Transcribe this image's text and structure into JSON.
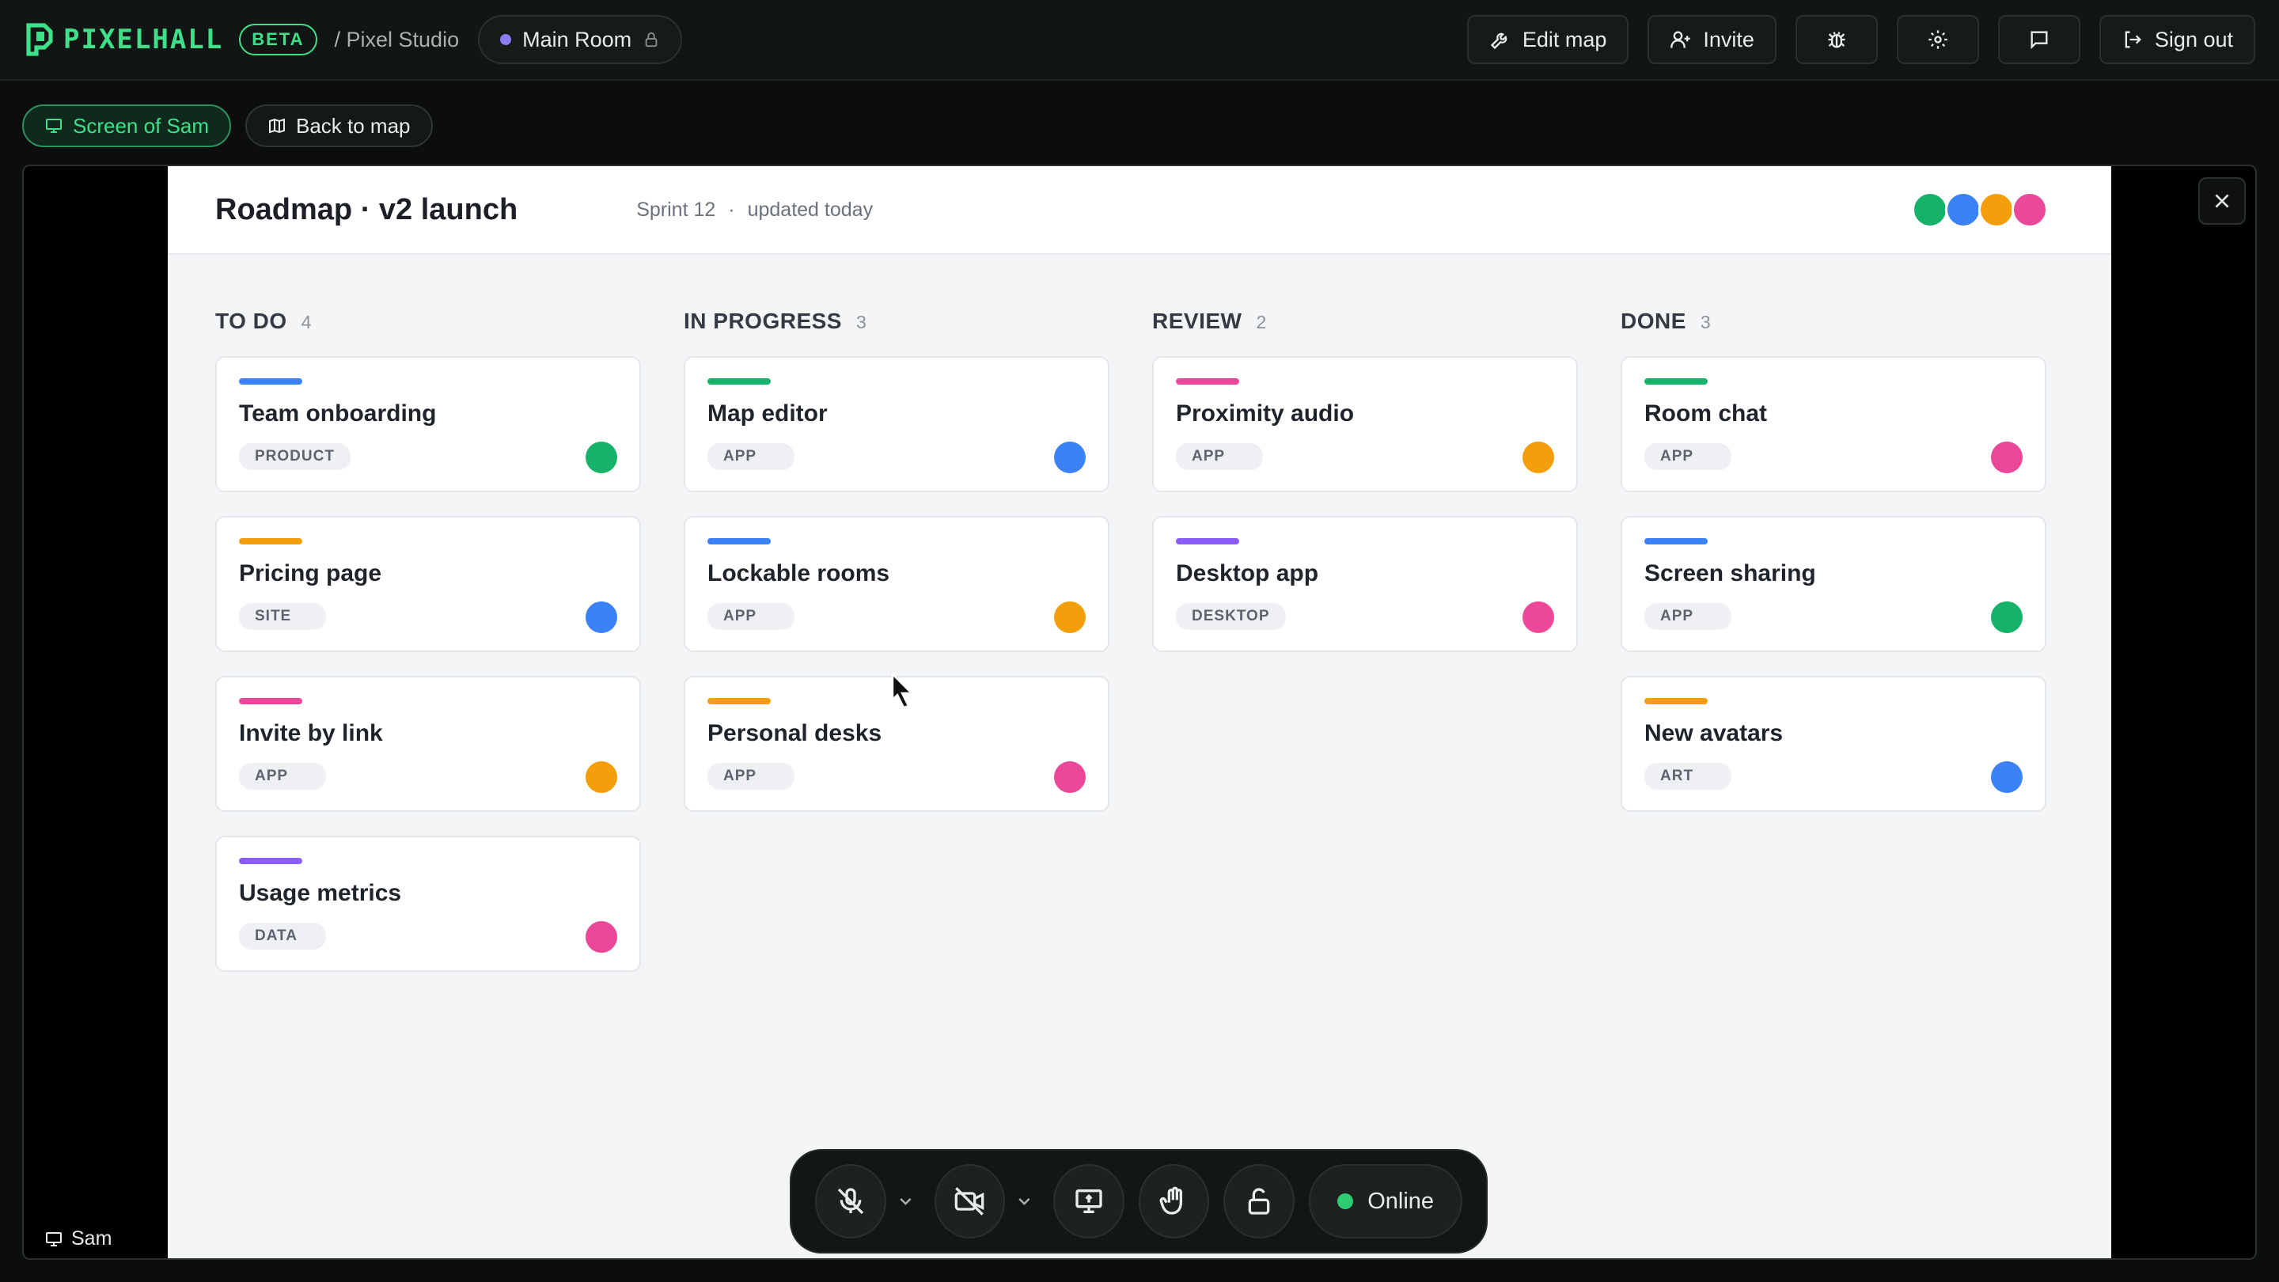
{
  "topbar": {
    "brand": "PIXELHALL",
    "badge": "BETA",
    "breadcrumb": "/ Pixel Studio",
    "room": "Main Room",
    "actions": {
      "edit_map": "Edit map",
      "invite": "Invite",
      "sign_out": "Sign out"
    }
  },
  "subbar": {
    "screen_chip": "Screen of Sam",
    "back_chip": "Back to map"
  },
  "share": {
    "presenter": "Sam",
    "board": {
      "title": "Roadmap · v2 launch",
      "sprint": "Sprint 12",
      "separator": "·",
      "updated": "updated today",
      "avatar_colors": [
        "#17b26a",
        "#3b82f6",
        "#f59e0b",
        "#ec4899"
      ],
      "columns": [
        {
          "title": "TO DO",
          "count": "4",
          "cards": [
            {
              "title": "Team onboarding",
              "tag": "PRODUCT",
              "bar": "#3b82f6",
              "who": "#17b26a"
            },
            {
              "title": "Pricing page",
              "tag": "SITE",
              "bar": "#f59e0b",
              "who": "#3b82f6"
            },
            {
              "title": "Invite by link",
              "tag": "APP",
              "bar": "#ec4899",
              "who": "#f59e0b"
            },
            {
              "title": "Usage metrics",
              "tag": "DATA",
              "bar": "#8b5cf6",
              "who": "#ec4899"
            }
          ]
        },
        {
          "title": "IN PROGRESS",
          "count": "3",
          "cards": [
            {
              "title": "Map editor",
              "tag": "APP",
              "bar": "#17b26a",
              "who": "#3b82f6"
            },
            {
              "title": "Lockable rooms",
              "tag": "APP",
              "bar": "#3b82f6",
              "who": "#f59e0b"
            },
            {
              "title": "Personal desks",
              "tag": "APP",
              "bar": "#f59e0b",
              "who": "#ec4899"
            }
          ]
        },
        {
          "title": "REVIEW",
          "count": "2",
          "cards": [
            {
              "title": "Proximity audio",
              "tag": "APP",
              "bar": "#ec4899",
              "who": "#f59e0b"
            },
            {
              "title": "Desktop app",
              "tag": "DESKTOP",
              "bar": "#8b5cf6",
              "who": "#ec4899"
            }
          ]
        },
        {
          "title": "DONE",
          "count": "3",
          "cards": [
            {
              "title": "Room chat",
              "tag": "APP",
              "bar": "#17b26a",
              "who": "#ec4899"
            },
            {
              "title": "Screen sharing",
              "tag": "APP",
              "bar": "#3b82f6",
              "who": "#17b26a"
            },
            {
              "title": "New avatars",
              "tag": "ART",
              "bar": "#f59e0b",
              "who": "#3b82f6"
            }
          ]
        }
      ]
    }
  },
  "dock": {
    "status": "Online"
  },
  "colors": {
    "accent": "#3ee08a",
    "online": "#2ecc71",
    "room_dot": "#8b7cf6"
  },
  "icons": [
    "pixelhall-logo-icon",
    "lock-icon",
    "wrench-icon",
    "add-user-icon",
    "bug-icon",
    "gear-icon",
    "chat-icon",
    "sign-out-icon",
    "monitor-icon",
    "map-icon",
    "close-icon",
    "mic-off-icon",
    "camera-off-icon",
    "screen-share-icon",
    "hand-icon",
    "unlock-icon",
    "chevron-down-icon"
  ]
}
